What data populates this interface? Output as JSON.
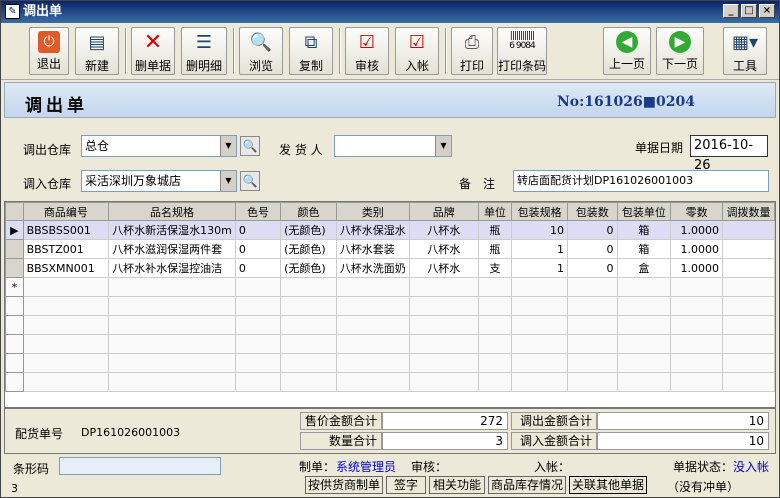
{
  "window": {
    "title": "调出单",
    "min": "_",
    "max": "□",
    "close": "×"
  },
  "toolbar": {
    "exit": "退出",
    "new": "新建",
    "delete_doc": "删单据",
    "delete_detail": "删明细",
    "browse": "浏览",
    "copy": "复制",
    "audit": "审核",
    "post": "入帐",
    "print": "打印",
    "print_barcode": "打印条码",
    "barcode_digits": "6 9084",
    "prev": "上一页",
    "next": "下一页",
    "tools": "工具"
  },
  "header": {
    "title": "调出单",
    "doc_no": "No:161026■0204"
  },
  "form": {
    "out_wh_label": "调出仓库",
    "out_wh_value": "总仓",
    "shipper_label": "发 货 人",
    "shipper_value": "",
    "date_label": "单据日期",
    "date_value": "2016-10-26",
    "in_wh_label": "调入仓库",
    "in_wh_value": "采活深圳万象城店",
    "remark_label": "备　注",
    "remark_value": "转店面配货计划DP161026001003"
  },
  "grid": {
    "columns": [
      "商品编号",
      "品名规格",
      "色号",
      "颜色",
      "类别",
      "品牌",
      "单位",
      "包装规格",
      "包装数",
      "包装单位",
      "零数",
      "调拨数量"
    ],
    "rows": [
      [
        "BBSBSS001",
        "八杯水新活保湿水130m",
        "0",
        "(无颜色)",
        "八杯水保湿水",
        "八杯水",
        "瓶",
        "10",
        "0",
        "箱",
        "1.0000",
        ""
      ],
      [
        "BBSTZ001",
        "八杯水滋润保湿两件套",
        "0",
        "(无颜色)",
        "八杯水套装",
        "八杯水",
        "瓶",
        "1",
        "0",
        "箱",
        "1.0000",
        ""
      ],
      [
        "BBSXMN001",
        "八杯水补水保湿控油洁",
        "0",
        "(无颜色)",
        "八杯水洗面奶",
        "八杯水",
        "支",
        "1",
        "0",
        "盒",
        "1.0000",
        ""
      ]
    ],
    "new_row_marker": "*"
  },
  "footer": {
    "dist_no_label": "配货单号",
    "dist_no_value": "DP161026001003",
    "sale_total_label": "售价金额合计",
    "sale_total_value": "272",
    "qty_total_label": "数量合计",
    "qty_total_value": "3",
    "out_amount_label": "调出金额合计",
    "out_amount_value": "10",
    "in_amount_label": "调入金额合计",
    "in_amount_value": "10"
  },
  "status": {
    "barcode_label": "条形码",
    "maker_label": "制单：",
    "maker_value": "系统管理员",
    "auditor_label": "审核：",
    "post_label": "入帐：",
    "state_label": "单据状态：",
    "state_value": "没入帐",
    "count": "3"
  },
  "bottom_buttons": {
    "supplier": "按供货商制单",
    "sign": "签字",
    "related": "相关功能",
    "stock": "商品库存情况",
    "link": "关联其他单据",
    "no_offset": "（没有冲单）"
  },
  "colors": {
    "accent": "#1a3a8a",
    "status_link": "#0000cc"
  }
}
